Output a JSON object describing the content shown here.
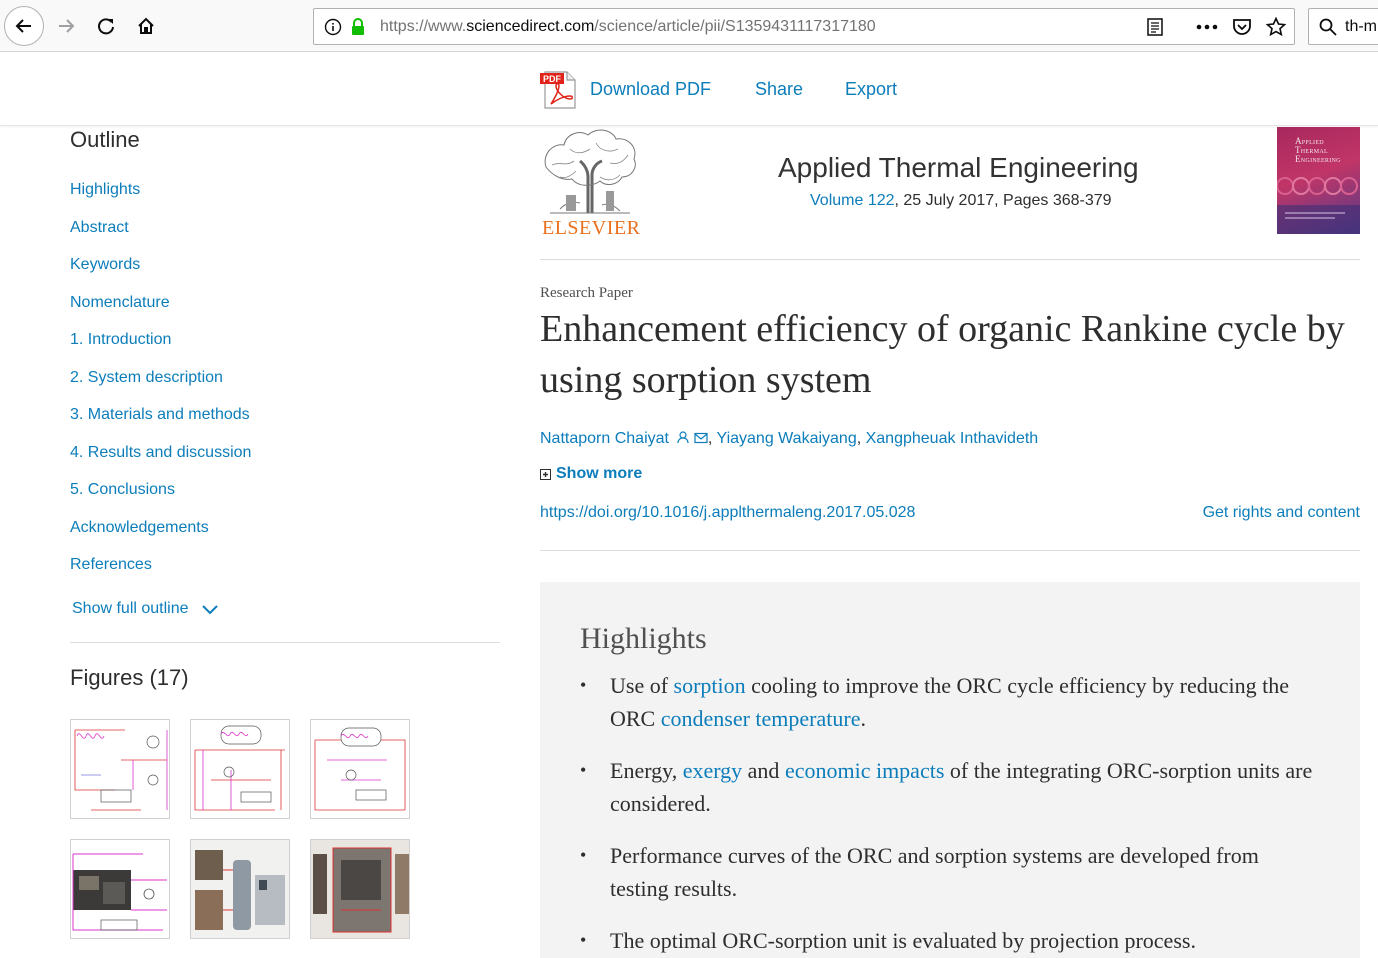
{
  "browser": {
    "url_prefix": "https://www.",
    "url_host": "sciencedirect.com",
    "url_path": "/science/article/pii/S1359431117317180",
    "search_text": "th-m"
  },
  "toolbar": {
    "download_pdf": "Download PDF",
    "share": "Share",
    "export": "Export"
  },
  "outline": {
    "title": "Outline",
    "items": [
      "Highlights",
      "Abstract",
      "Keywords",
      "Nomenclature",
      "1. Introduction",
      "2. System description",
      "3. Materials and methods",
      "4. Results and discussion",
      "5. Conclusions",
      "Acknowledgements",
      "References"
    ],
    "show_full": "Show full outline"
  },
  "figures": {
    "title": "Figures (17)"
  },
  "journal": {
    "publisher": "ELSEVIER",
    "name": "Applied Thermal Engineering",
    "volume_link": "Volume 122",
    "volume_rest": ", 25 July 2017, Pages 368-379",
    "cover_title_1": "Applied",
    "cover_title_2": "Thermal",
    "cover_title_3": "Engineering"
  },
  "article": {
    "type": "Research Paper",
    "title": "Enhancement efficiency of organic Rankine cycle by using sorption system",
    "author_1": "Nattaporn Chaiyat",
    "author_2": "Yiayang Wakaiyang",
    "author_3": "Xangpheuak Inthavideth",
    "show_more": "Show more",
    "doi": "https://doi.org/10.1016/j.applthermaleng.2017.05.028",
    "rights": "Get rights and content"
  },
  "highlights": {
    "title": "Highlights",
    "h1_a": "Use of ",
    "h1_link1": "sorption",
    "h1_b": " cooling to improve the ORC cycle efficiency by reducing the ORC ",
    "h1_link2": "condenser temperature",
    "h1_c": ".",
    "h2_a": "Energy, ",
    "h2_link1": "exergy",
    "h2_b": " and ",
    "h2_link2": "economic impacts",
    "h2_c": " of the integrating ORC-sorption units are considered.",
    "h3": "Performance curves of the ORC and sorption systems are developed from testing results.",
    "h4": "The optimal ORC-sorption unit is evaluated by projection process."
  },
  "colors": {
    "link": "#0c7dbb",
    "text": "#2e2e2e",
    "elsevier_orange": "#e9711c",
    "highlight_bg": "#f3f3f3"
  }
}
